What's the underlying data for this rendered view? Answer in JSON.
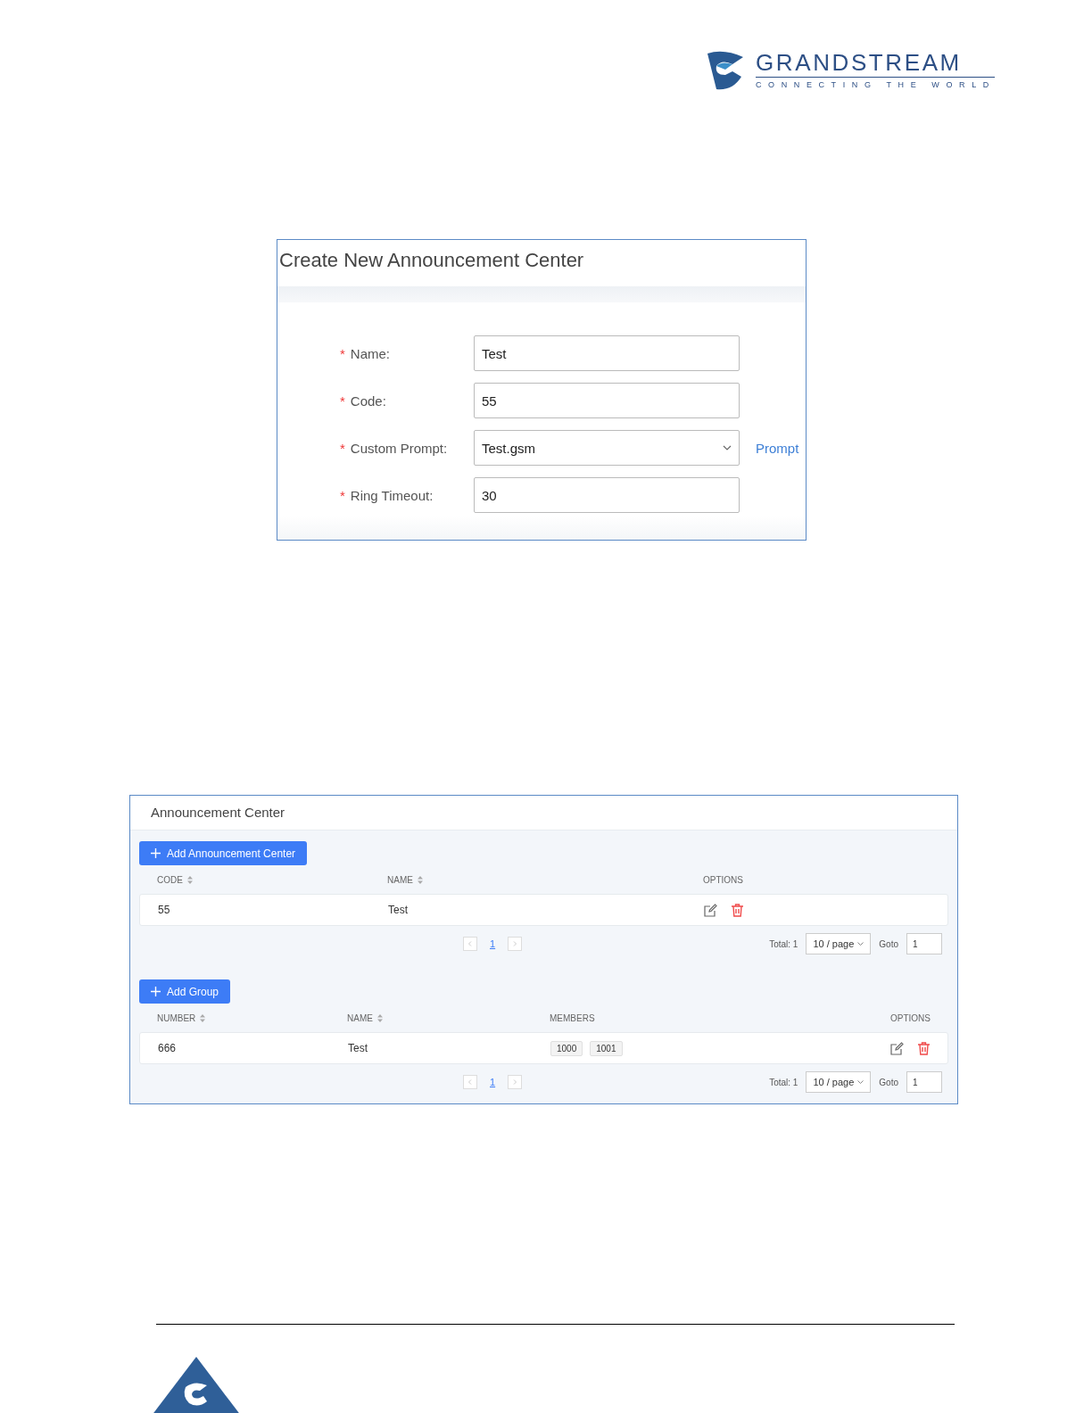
{
  "header": {
    "logo_name": "GRANDSTREAM",
    "logo_tagline": "CONNECTING THE WORLD"
  },
  "form": {
    "title": "Create New Announcement Center",
    "fields": [
      {
        "label": "Name:",
        "required_mark": "*",
        "kind": "text",
        "value": "Test"
      },
      {
        "label": "Code:",
        "required_mark": "*",
        "kind": "text",
        "value": "55"
      },
      {
        "label": "Custom Prompt:",
        "required_mark": "*",
        "kind": "select",
        "value": "Test.gsm",
        "link": "Prompt"
      },
      {
        "label": "Ring Timeout:",
        "required_mark": "*",
        "kind": "text",
        "value": "30"
      }
    ]
  },
  "list": {
    "title": "Announcement Center",
    "tables": [
      {
        "add_button": "Add Announcement Center",
        "columns": [
          {
            "label": "CODE",
            "sortable": true,
            "kind": "text"
          },
          {
            "label": "NAME",
            "sortable": true,
            "kind": "text"
          },
          {
            "label": "OPTIONS",
            "sortable": false,
            "kind": "actions"
          }
        ],
        "rows": [
          {
            "cells": [
              "55",
              "Test"
            ]
          }
        ],
        "pagination": {
          "page": "1",
          "total": "Total: 1",
          "page_size": "10 / page",
          "goto_label": "Goto",
          "goto_value": "1"
        }
      },
      {
        "add_button": "Add Group",
        "columns": [
          {
            "label": "NUMBER",
            "sortable": true,
            "kind": "text"
          },
          {
            "label": "NAME",
            "sortable": true,
            "kind": "text"
          },
          {
            "label": "MEMBERS",
            "sortable": false,
            "kind": "tags"
          },
          {
            "label": "OPTIONS",
            "sortable": false,
            "kind": "actions"
          }
        ],
        "rows": [
          {
            "cells": [
              "666",
              "Test",
              [
                "1000",
                "1001"
              ]
            ]
          }
        ],
        "pagination": {
          "page": "1",
          "total": "Total: 1",
          "page_size": "10 / page",
          "goto_label": "Goto",
          "goto_value": "1"
        }
      }
    ]
  }
}
